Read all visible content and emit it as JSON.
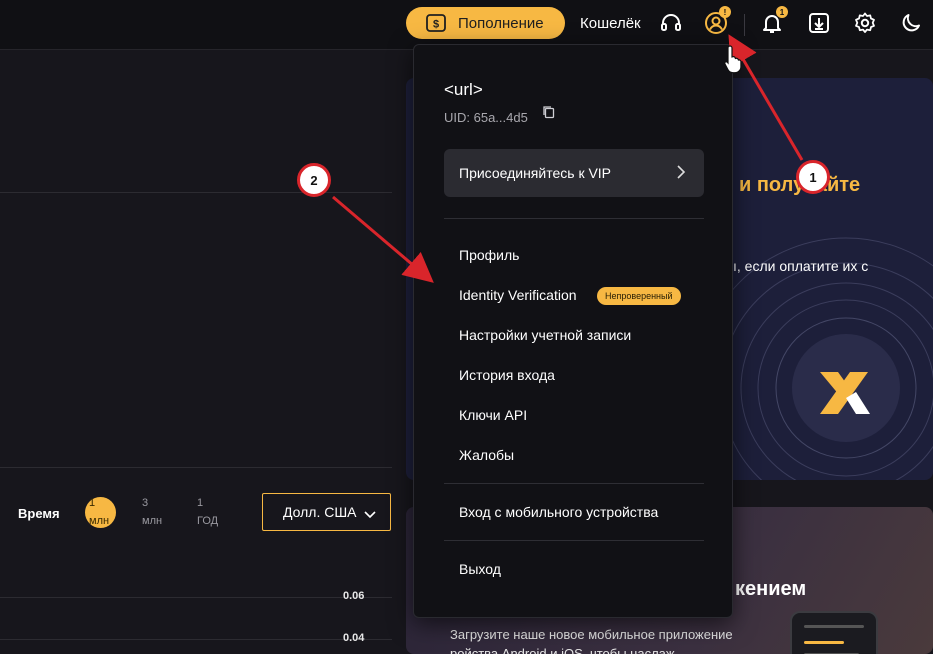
{
  "topbar": {
    "deposit_label": "Пополнение",
    "wallet_label": "Кошелёк",
    "profile_badge": "!",
    "bell_badge": "1"
  },
  "chart_controls": {
    "time_label": "Время",
    "periods": [
      {
        "line1": "1",
        "line2": "млн",
        "active": true
      },
      {
        "line1": "3",
        "line2": "млн",
        "active": false
      },
      {
        "line1": "1",
        "line2": "ГОД",
        "active": false
      }
    ],
    "currency_label": "Долл. США",
    "axis_values": [
      "0.06",
      "0.04"
    ]
  },
  "promo": {
    "headline_fragment": "и получайте",
    "sub_fragment": "ı, если оплатите их с",
    "app_headline_fragment": "кением",
    "app_text_line1": "Загрузите наше новое мобильное приложение",
    "app_text_line2": "ройства Android и iOS, чтобы наслаж"
  },
  "dropdown": {
    "title": "<url>",
    "uid": "UID: 65a...4d5",
    "vip_label": "Присоединяйтесь к VIP",
    "items": [
      {
        "label": "Профиль"
      },
      {
        "label": "Identity Verification"
      },
      {
        "label": "Настройки учетной записи"
      },
      {
        "label": "История входа"
      },
      {
        "label": "Ключи API"
      },
      {
        "label": "Жалобы"
      }
    ],
    "unverified_badge": "Непроверенный",
    "mobile_login": "Вход с мобильного устройства",
    "logout": "Выход"
  },
  "annotations": {
    "marker_1": "1",
    "marker_2": "2"
  },
  "colors": {
    "accent": "#f7b843",
    "background": "#17161c",
    "topbar": "#101014",
    "dropdown": "#111115",
    "annotation_red": "#d9252b"
  }
}
